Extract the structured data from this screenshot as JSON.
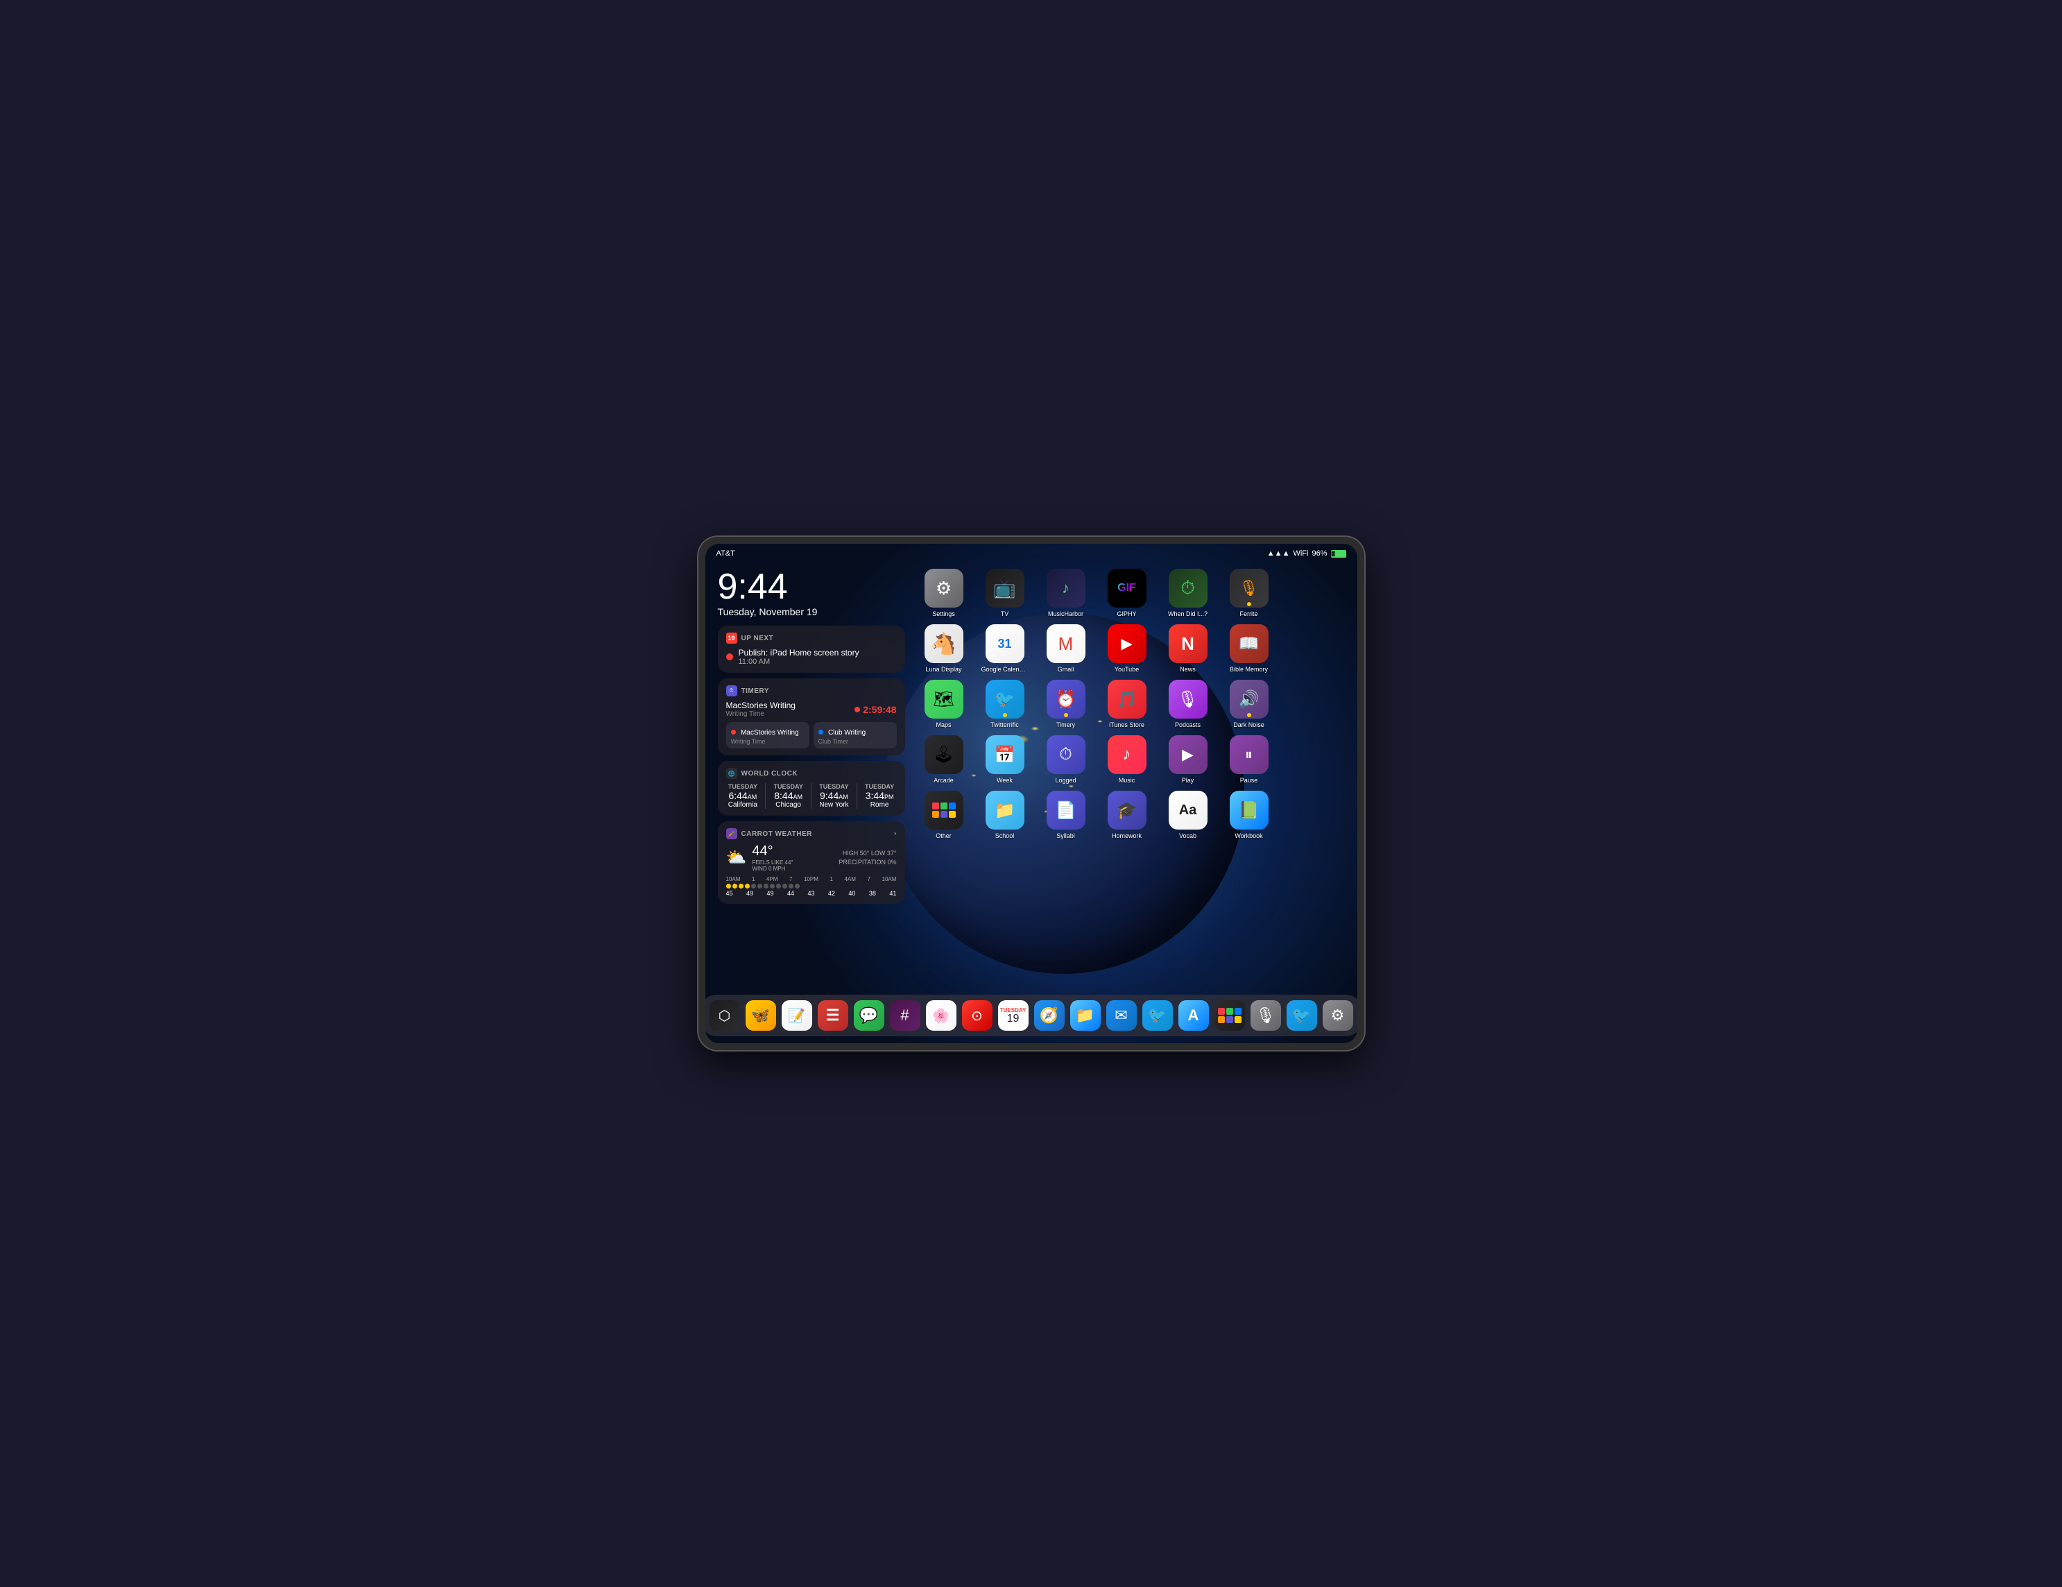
{
  "device": {
    "carrier": "AT&T",
    "signal": "●●●",
    "wifi": "wifi",
    "battery": "96%"
  },
  "clock": {
    "time": "9:44",
    "date": "Tuesday, November 19"
  },
  "widgets": {
    "upnext": {
      "header": "UP NEXT",
      "event_title": "Publish: iPad Home screen story",
      "event_time": "11:00 AM"
    },
    "timery": {
      "header": "TIMERY",
      "current_task": "MacStories Writing",
      "current_type": "Writing Time",
      "timer": "2:59:48",
      "entry1_name": "MacStories Writing",
      "entry1_type": "Writing Time",
      "entry2_name": "Club Writing",
      "entry2_type": "Club Timer"
    },
    "worldclock": {
      "header": "WORLD CLOCK",
      "cities": [
        {
          "day": "TUESDAY",
          "time": "6:44",
          "ampm": "AM",
          "city": "California"
        },
        {
          "day": "TUESDAY",
          "time": "8:44",
          "ampm": "AM",
          "city": "Chicago"
        },
        {
          "day": "TUESDAY",
          "time": "9:44",
          "ampm": "AM",
          "city": "New York"
        },
        {
          "day": "TUESDAY",
          "time": "3:44",
          "ampm": "PM",
          "city": "Rome"
        }
      ]
    },
    "weather": {
      "header": "CARROT WEATHER",
      "temp": "44°",
      "feels_like": "FEELS LIKE 44°",
      "wind": "WIND 0 MPH",
      "high": "HIGH 50°",
      "low": "LOW 37°",
      "precip": "PRECIPITATION 0%",
      "hourly_labels": [
        "10AM",
        "1",
        "4PM",
        "7",
        "10PM",
        "1",
        "4AM",
        "7",
        "10AM"
      ],
      "hourly_temps": [
        "45",
        "49",
        "49",
        "44",
        "43",
        "42",
        "40",
        "38",
        "41"
      ]
    }
  },
  "apps": {
    "row1": [
      {
        "name": "Settings",
        "icon_class": "ic-settings",
        "symbol": "⚙️"
      },
      {
        "name": "TV",
        "icon_class": "ic-tv",
        "symbol": "📺"
      },
      {
        "name": "MusicHarbor",
        "icon_class": "ic-musicharbor",
        "symbol": "🎵"
      },
      {
        "name": "GIPHY",
        "icon_class": "ic-giphy",
        "symbol": "GIF"
      },
      {
        "name": "When Did I...?",
        "icon_class": "ic-whendidit",
        "symbol": "⏱"
      },
      {
        "name": "Ferrite",
        "icon_class": "ic-ferrite",
        "symbol": "🎙"
      }
    ],
    "row2": [
      {
        "name": "Luna Display",
        "icon_class": "ic-luna",
        "symbol": "🐴"
      },
      {
        "name": "Google Calendar",
        "icon_class": "ic-gcal",
        "symbol": "31"
      },
      {
        "name": "Gmail",
        "icon_class": "ic-gmail",
        "symbol": "M"
      },
      {
        "name": "YouTube",
        "icon_class": "ic-youtube",
        "symbol": "▶"
      },
      {
        "name": "News",
        "icon_class": "ic-news",
        "symbol": "N"
      },
      {
        "name": "Bible Memory",
        "icon_class": "ic-bible",
        "symbol": "📖"
      }
    ],
    "row3": [
      {
        "name": "Maps",
        "icon_class": "ic-maps",
        "symbol": "🗺"
      },
      {
        "name": "Twitterrific",
        "icon_class": "ic-twitterrific",
        "symbol": "🐦",
        "dot": true,
        "dot_color": "yellow"
      },
      {
        "name": "Timery",
        "icon_class": "ic-timery",
        "symbol": "⏰",
        "dot": true,
        "dot_color": "yellow"
      },
      {
        "name": "iTunes Store",
        "icon_class": "ic-itunesstore",
        "symbol": "🎵"
      },
      {
        "name": "Podcasts",
        "icon_class": "ic-podcasts",
        "symbol": "🎙"
      },
      {
        "name": "Dark Noise",
        "icon_class": "ic-darknoise",
        "symbol": "🔊",
        "dot": true,
        "dot_color": "yellow"
      }
    ],
    "row4": [
      {
        "name": "Arcade",
        "icon_class": "ic-arcade",
        "symbol": "🕹"
      },
      {
        "name": "Week",
        "icon_class": "ic-week",
        "symbol": "📅"
      },
      {
        "name": "Logged",
        "icon_class": "ic-logged",
        "symbol": "⏱"
      },
      {
        "name": "Music",
        "icon_class": "ic-music",
        "symbol": "♪"
      },
      {
        "name": "Play",
        "icon_class": "ic-play",
        "symbol": "▶"
      },
      {
        "name": "Pause",
        "icon_class": "ic-pause",
        "symbol": "⏸"
      }
    ],
    "row5": [
      {
        "name": "Other",
        "icon_class": "ic-other",
        "symbol": "⊞"
      },
      {
        "name": "School",
        "icon_class": "ic-school",
        "symbol": "📁"
      },
      {
        "name": "Syllabi",
        "icon_class": "ic-syllabi",
        "symbol": "📄"
      },
      {
        "name": "Homework",
        "icon_class": "ic-homework",
        "symbol": "🎓"
      },
      {
        "name": "Vocab",
        "icon_class": "ic-vocab",
        "symbol": "Aa"
      },
      {
        "name": "Workbook",
        "icon_class": "ic-workbook",
        "symbol": "📗"
      }
    ]
  },
  "dock": {
    "items": [
      {
        "name": "Touch ID",
        "icon_class": "dic-touch",
        "symbol": "⬡"
      },
      {
        "name": "Tes",
        "icon_class": "dic-tes",
        "symbol": "🦋"
      },
      {
        "name": "Notes",
        "icon_class": "dic-notes",
        "symbol": "📝"
      },
      {
        "name": "Todoist",
        "icon_class": "dic-todoist",
        "symbol": "✓"
      },
      {
        "name": "Messages",
        "icon_class": "dic-messages",
        "symbol": "💬"
      },
      {
        "name": "Slack",
        "icon_class": "dic-slack",
        "symbol": "#"
      },
      {
        "name": "Photos",
        "icon_class": "dic-photos",
        "symbol": "🌸"
      },
      {
        "name": "Reminders",
        "icon_class": "dic-reminders",
        "symbol": "⊙"
      },
      {
        "name": "Calendar",
        "icon_class": "dic-calendar",
        "symbol": "19"
      },
      {
        "name": "Safari",
        "icon_class": "dic-safari",
        "symbol": "🧭"
      },
      {
        "name": "Files",
        "icon_class": "dic-files",
        "symbol": "📁"
      },
      {
        "name": "Mail",
        "icon_class": "dic-mail",
        "symbol": "✉"
      },
      {
        "name": "Twitter",
        "icon_class": "dic-twitter",
        "symbol": "🐦"
      },
      {
        "name": "App Store",
        "icon_class": "dic-appstore",
        "symbol": "A"
      },
      {
        "name": "Launchpad",
        "icon_class": "dic-launchpad",
        "symbol": "⊞"
      },
      {
        "name": "Mic",
        "icon_class": "dic-mic",
        "symbol": "🎙"
      },
      {
        "name": "Twitterrific",
        "icon_class": "dic-twitterrific",
        "symbol": "🐦"
      },
      {
        "name": "Settings",
        "icon_class": "dic-settings",
        "symbol": "⚙"
      }
    ]
  }
}
